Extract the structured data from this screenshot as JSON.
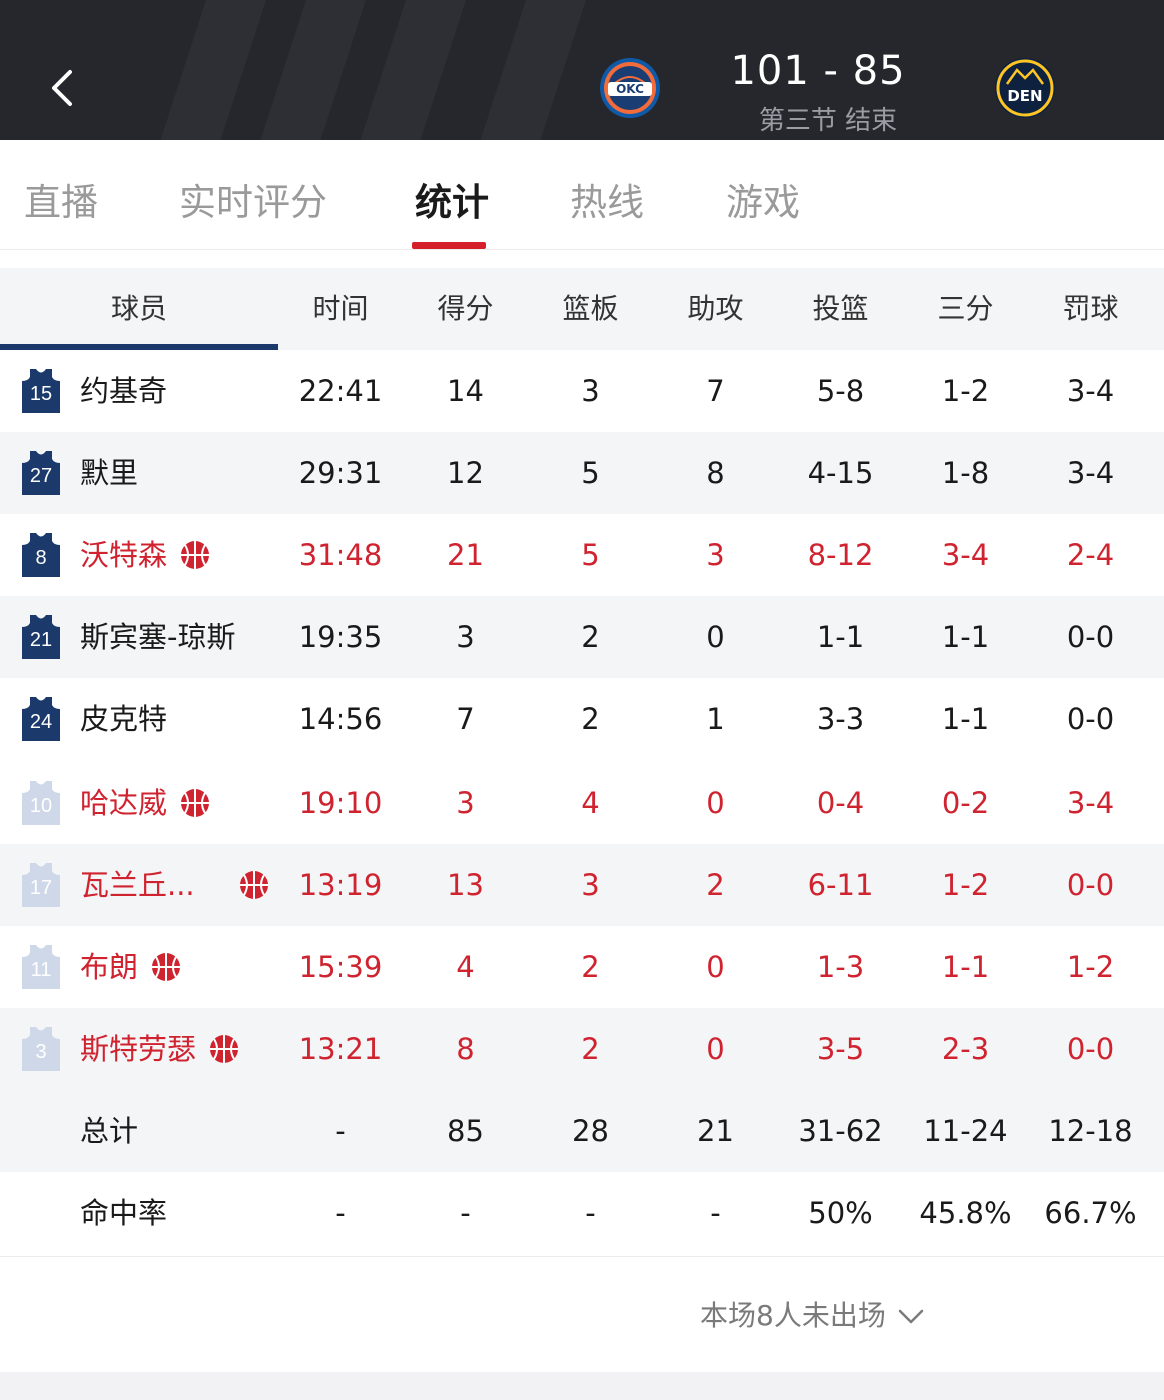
{
  "header": {
    "score": "101 - 85",
    "period": "第三节 结束",
    "home_logo_text": "OKC",
    "away_logo_text": "DEN",
    "background_color": "#25272c"
  },
  "tabs": [
    {
      "label": "直播"
    },
    {
      "label": "实时评分"
    },
    {
      "label": "统计",
      "active": true
    },
    {
      "label": "热线"
    },
    {
      "label": "游戏"
    }
  ],
  "table": {
    "headers": [
      "球员",
      "时间",
      "得分",
      "篮板",
      "助攻",
      "投篮",
      "三分",
      "罚球"
    ],
    "starters": [
      {
        "number": "15",
        "name": "约基奇",
        "time": "22:41",
        "pts": "14",
        "reb": "3",
        "ast": "7",
        "fg": "5-8",
        "three": "1-2",
        "ft": "3-4",
        "on_court": false
      },
      {
        "number": "27",
        "name": "默里",
        "time": "29:31",
        "pts": "12",
        "reb": "5",
        "ast": "8",
        "fg": "4-15",
        "three": "1-8",
        "ft": "3-4",
        "on_court": false
      },
      {
        "number": "8",
        "name": "沃特森",
        "time": "31:48",
        "pts": "21",
        "reb": "5",
        "ast": "3",
        "fg": "8-12",
        "three": "3-4",
        "ft": "2-4",
        "on_court": true
      },
      {
        "number": "21",
        "name": "斯宾塞-琼斯",
        "time": "19:35",
        "pts": "3",
        "reb": "2",
        "ast": "0",
        "fg": "1-1",
        "three": "1-1",
        "ft": "0-0",
        "on_court": false
      },
      {
        "number": "24",
        "name": "皮克特",
        "time": "14:56",
        "pts": "7",
        "reb": "2",
        "ast": "1",
        "fg": "3-3",
        "three": "1-1",
        "ft": "0-0",
        "on_court": false
      }
    ],
    "bench": [
      {
        "number": "10",
        "name": "哈达威",
        "time": "19:10",
        "pts": "3",
        "reb": "4",
        "ast": "0",
        "fg": "0-4",
        "three": "0-2",
        "ft": "3-4",
        "on_court": true
      },
      {
        "number": "17",
        "name": "瓦兰丘...",
        "time": "13:19",
        "pts": "13",
        "reb": "3",
        "ast": "2",
        "fg": "6-11",
        "three": "1-2",
        "ft": "0-0",
        "on_court": true
      },
      {
        "number": "11",
        "name": "布朗",
        "time": "15:39",
        "pts": "4",
        "reb": "2",
        "ast": "0",
        "fg": "1-3",
        "three": "1-1",
        "ft": "1-2",
        "on_court": true
      },
      {
        "number": "3",
        "name": "斯特劳瑟",
        "time": "13:21",
        "pts": "8",
        "reb": "2",
        "ast": "0",
        "fg": "3-5",
        "three": "2-3",
        "ft": "0-0",
        "on_court": true
      }
    ],
    "totals": {
      "label": "总计",
      "time": "-",
      "pts": "85",
      "reb": "28",
      "ast": "21",
      "fg": "31-62",
      "three": "11-24",
      "ft": "12-18"
    },
    "pct": {
      "label": "命中率",
      "time": "-",
      "pts": "-",
      "reb": "-",
      "ast": "-",
      "fg": "50%",
      "three": "45.8%",
      "ft": "66.7%"
    }
  },
  "footer": {
    "more_label": "本场8人未出场"
  },
  "colors": {
    "accent_red": "#d02330",
    "navy": "#1b3a6b",
    "bench_jersey": "#cfd8e8"
  },
  "icons": {
    "back": "chevron-left-icon",
    "on_court": "basketball-icon",
    "expand": "chevron-down-icon"
  }
}
